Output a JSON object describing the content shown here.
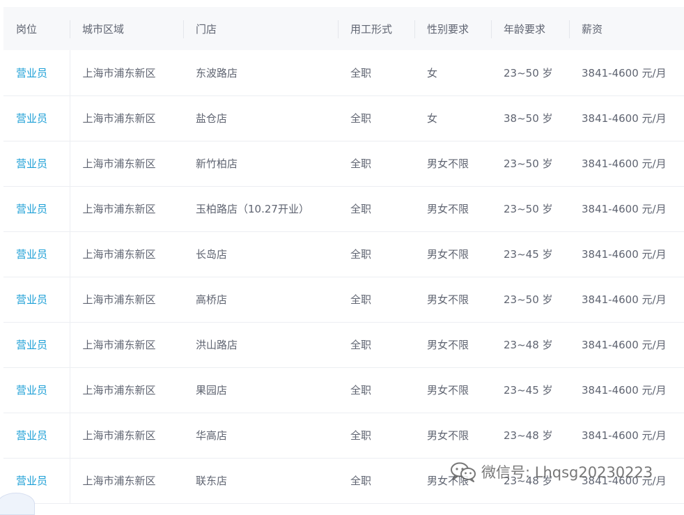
{
  "table": {
    "headers": [
      "岗位",
      "城市区域",
      "门店",
      "用工形式",
      "性别要求",
      "年龄要求",
      "薪资"
    ],
    "rows": [
      {
        "role": "营业员",
        "city": "上海市浦东新区",
        "store": "东波路店",
        "type": "全职",
        "gender": "女",
        "age": "23~50 岁",
        "salary": "3841-4600 元/月"
      },
      {
        "role": "营业员",
        "city": "上海市浦东新区",
        "store": "盐仓店",
        "type": "全职",
        "gender": "女",
        "age": "38~50 岁",
        "salary": "3841-4600 元/月"
      },
      {
        "role": "营业员",
        "city": "上海市浦东新区",
        "store": "新竹柏店",
        "type": "全职",
        "gender": "男女不限",
        "age": "23~50 岁",
        "salary": "3841-4600 元/月"
      },
      {
        "role": "营业员",
        "city": "上海市浦东新区",
        "store": "玉柏路店（10.27开业）",
        "type": "全职",
        "gender": "男女不限",
        "age": "23~50 岁",
        "salary": "3841-4600 元/月"
      },
      {
        "role": "营业员",
        "city": "上海市浦东新区",
        "store": "长岛店",
        "type": "全职",
        "gender": "男女不限",
        "age": "23~45 岁",
        "salary": "3841-4600 元/月"
      },
      {
        "role": "营业员",
        "city": "上海市浦东新区",
        "store": "高桥店",
        "type": "全职",
        "gender": "男女不限",
        "age": "23~50 岁",
        "salary": "3841-4600 元/月"
      },
      {
        "role": "营业员",
        "city": "上海市浦东新区",
        "store": "洪山路店",
        "type": "全职",
        "gender": "男女不限",
        "age": "23~48 岁",
        "salary": "3841-4600 元/月"
      },
      {
        "role": "营业员",
        "city": "上海市浦东新区",
        "store": "果园店",
        "type": "全职",
        "gender": "男女不限",
        "age": "23~45 岁",
        "salary": "3841-4600 元/月"
      },
      {
        "role": "营业员",
        "city": "上海市浦东新区",
        "store": "华高店",
        "type": "全职",
        "gender": "男女不限",
        "age": "23~48 岁",
        "salary": "3841-4600 元/月"
      },
      {
        "role": "营业员",
        "city": "上海市浦东新区",
        "store": "联东店",
        "type": "全职",
        "gender": "男女不限",
        "age": "23~48 岁",
        "salary": "3841-4600 元/月"
      }
    ]
  },
  "watermark": {
    "text": "微信号: Lhqsg20230223",
    "icon": "wechat-icon"
  },
  "colors": {
    "link": "#1c9fd6",
    "text": "#5f6471",
    "header_bg": "#f7f8fa",
    "row_border": "#eceef2"
  }
}
